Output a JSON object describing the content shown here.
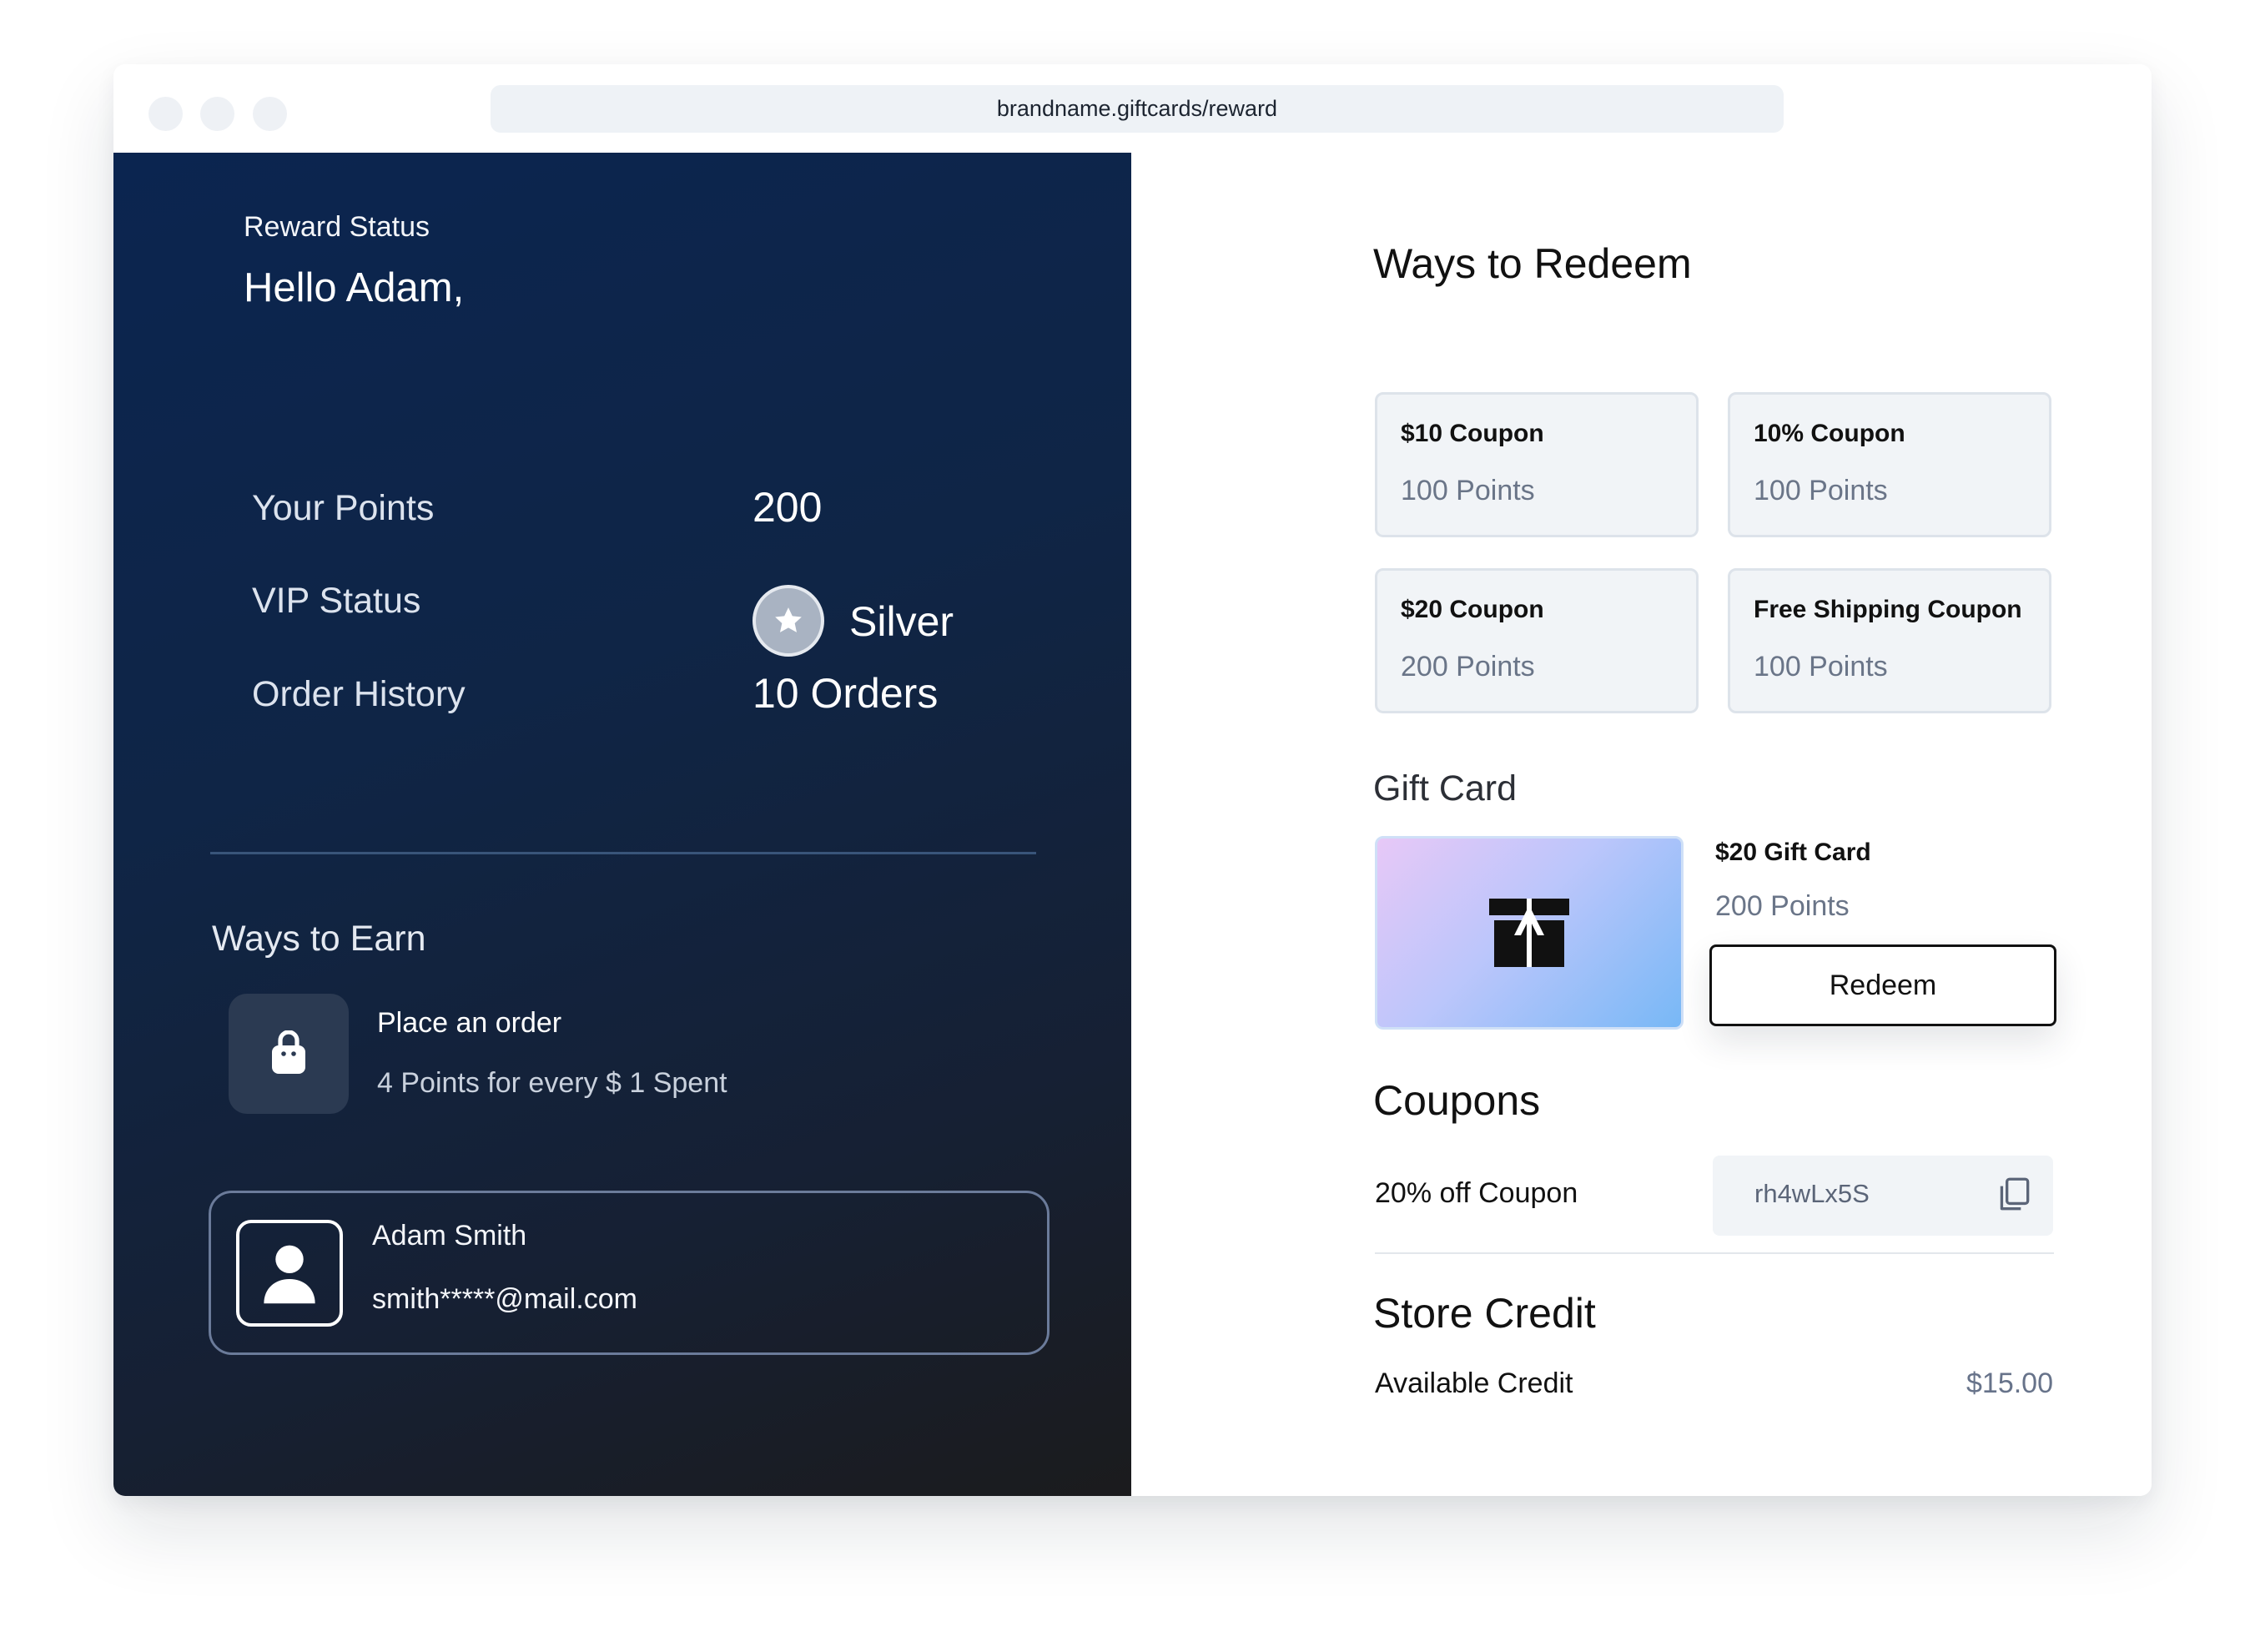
{
  "browser": {
    "url": "brandname.giftcards/reward"
  },
  "rewards": {
    "section_label": "Reward Status",
    "greeting": "Hello Adam,",
    "stats": {
      "points_label": "Your Points",
      "points_value": "200",
      "vip_label": "VIP Status",
      "vip_value": "Silver",
      "orders_label": "Order History",
      "orders_value": "10 Orders"
    },
    "earn": {
      "title": "Ways to Earn",
      "item_title": "Place an order",
      "item_subtitle": "4 Points for every $ 1 Spent"
    },
    "user": {
      "name": "Adam Smith",
      "email": "smith*****@mail.com"
    }
  },
  "redeem": {
    "title": "Ways to Redeem",
    "options": [
      {
        "name": "$10 Coupon",
        "points": "100 Points"
      },
      {
        "name": "10% Coupon",
        "points": "100 Points"
      },
      {
        "name": "$20 Coupon",
        "points": "200 Points"
      },
      {
        "name": "Free Shipping Coupon",
        "points": "100 Points"
      }
    ]
  },
  "gift_card": {
    "title": "Gift Card",
    "name": "$20 Gift Card",
    "points": "200 Points",
    "button_label": "Redeem"
  },
  "coupons": {
    "title": "Coupons",
    "label": "20% off Coupon",
    "code": "rh4wLx5S"
  },
  "store_credit": {
    "title": "Store Credit",
    "label": "Available Credit",
    "value": "$15.00"
  },
  "icons": {
    "vip": "star-icon",
    "earn": "shopping-bag-icon",
    "user": "user-icon",
    "gift": "gift-icon",
    "copy": "copy-icon"
  },
  "colors": {
    "panel_dark": "#0b2550",
    "panel_bottom": "#1b1b1d",
    "muted_text": "#6a7588",
    "card_bg": "#f1f4f7"
  }
}
